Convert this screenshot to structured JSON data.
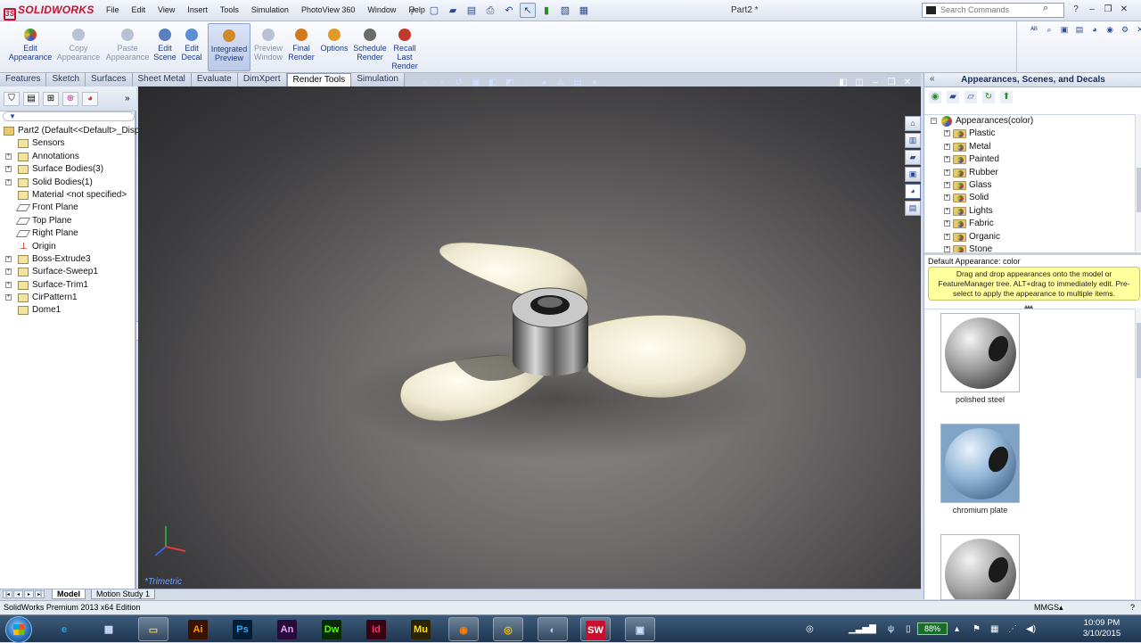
{
  "app": {
    "brand": "SOLIDWORKS",
    "document_title": "Part2 *",
    "menu": [
      "File",
      "Edit",
      "View",
      "Insert",
      "Tools",
      "Simulation",
      "PhotoView 360",
      "Window",
      "Help"
    ],
    "search_placeholder": "Search Commands"
  },
  "command_manager": {
    "buttons": [
      {
        "label": "Edit\nAppearance"
      },
      {
        "label": "Copy\nAppearance"
      },
      {
        "label": "Paste\nAppearance"
      },
      {
        "label": "Edit\nScene"
      },
      {
        "label": "Edit\nDecal"
      },
      {
        "label": "Integrated\nPreview"
      },
      {
        "label": "Preview\nWindow"
      },
      {
        "label": "Final\nRender"
      },
      {
        "label": "Options"
      },
      {
        "label": "Schedule\nRender"
      },
      {
        "label": "Recall\nLast\nRender"
      }
    ]
  },
  "tabs": [
    "Features",
    "Sketch",
    "Surfaces",
    "Sheet Metal",
    "Evaluate",
    "DimXpert",
    "Render Tools",
    "Simulation"
  ],
  "selected_tab": "Render Tools",
  "feature_tree": {
    "root": "Part2  (Default<<Default>_Disp",
    "items": [
      "Sensors",
      "Annotations",
      "Surface Bodies(3)",
      "Solid Bodies(1)",
      "Material <not specified>",
      "Front Plane",
      "Top Plane",
      "Right Plane",
      "Origin",
      "Boss-Extrude3",
      "Surface-Sweep1",
      "Surface-Trim1",
      "CirPattern1",
      "Dome1"
    ]
  },
  "viewport": {
    "view_name": "*Trimetric",
    "background_color": "#4a4849",
    "blade_color": "#f2efd8",
    "hub_color": "#8a8a8a"
  },
  "task_pane": {
    "title": "Appearances, Scenes, and Decals",
    "tree_root": "Appearances(color)",
    "categories": [
      "Plastic",
      "Metal",
      "Painted",
      "Rubber",
      "Glass",
      "Solid",
      "Lights",
      "Fabric",
      "Organic",
      "Stone"
    ],
    "default_appearance": "Default Appearance: color",
    "tip": "Drag and drop appearances onto the model or FeatureManager tree.  ALT+drag to immediately edit. Pre-select to apply the appearance to multiple items.",
    "swatches": [
      {
        "label": "polished steel"
      },
      {
        "label": "chromium plate"
      },
      {
        "label": ""
      }
    ]
  },
  "bottom_tabs": [
    "Model",
    "Motion Study 1"
  ],
  "status": {
    "text": "SolidWorks Premium 2013 x64 Edition",
    "units": "MMGS"
  },
  "taskbar": {
    "apps": [
      {
        "name": "Internet Explorer",
        "glyph": "e"
      },
      {
        "name": "Calculator",
        "glyph": "▦"
      },
      {
        "name": "File Explorer",
        "glyph": "▭"
      },
      {
        "name": "Illustrator",
        "glyph": "Ai"
      },
      {
        "name": "Photoshop",
        "glyph": "Ps"
      },
      {
        "name": "Animate",
        "glyph": "An"
      },
      {
        "name": "Dreamweaver",
        "glyph": "Dw"
      },
      {
        "name": "InDesign",
        "glyph": "Id"
      },
      {
        "name": "Muse",
        "glyph": "Mu"
      },
      {
        "name": "Firefox",
        "glyph": "◉"
      },
      {
        "name": "Chrome",
        "glyph": "◎"
      },
      {
        "name": "Media",
        "glyph": "◐"
      },
      {
        "name": "SolidWorks",
        "glyph": "SW"
      },
      {
        "name": "Window",
        "glyph": "▣"
      }
    ],
    "battery": "88%",
    "time": "10:09 PM",
    "date": "3/10/2015"
  }
}
